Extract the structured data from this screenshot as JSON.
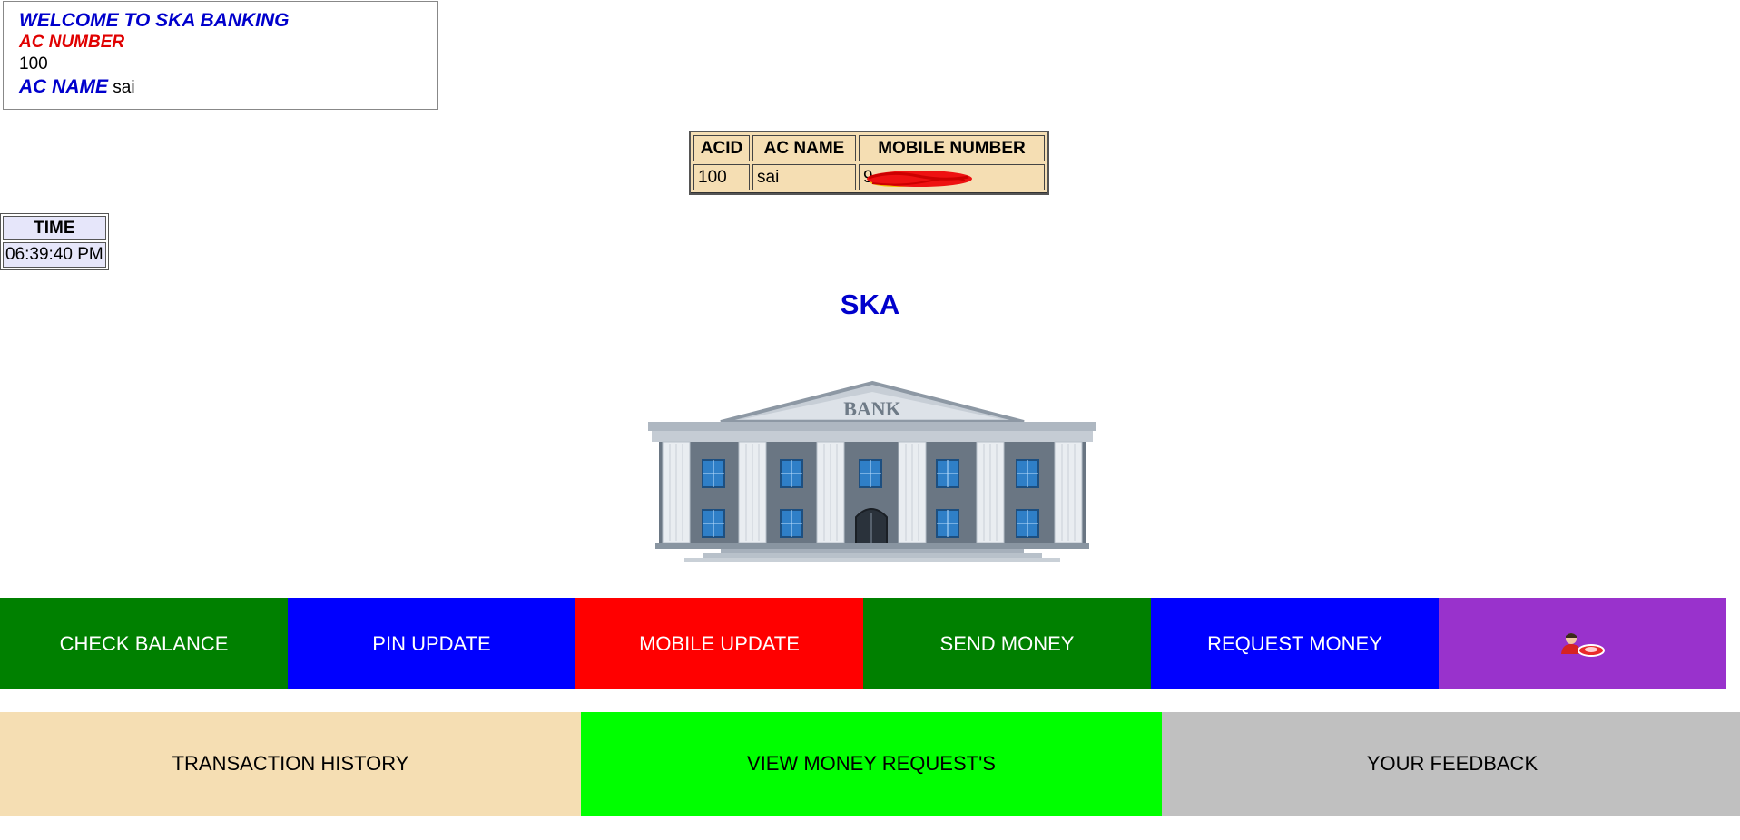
{
  "welcome": {
    "title": "WELCOME TO SKA BANKING",
    "ac_number_label": "AC NUMBER",
    "ac_number_value": "100",
    "ac_name_label": "AC NAME",
    "ac_name_value": "sai"
  },
  "account_table": {
    "headers": [
      "ACID",
      "AC NAME",
      "MOBILE NUMBER"
    ],
    "row": {
      "acid": "100",
      "ac_name": "sai",
      "mobile": "9"
    }
  },
  "time_table": {
    "header": "TIME",
    "value": "06:39:40 PM"
  },
  "heading": "SKA",
  "bank_image": {
    "sign_text": "BANK"
  },
  "actions_row1": [
    {
      "label": "CHECK BALANCE",
      "color": "#008000"
    },
    {
      "label": "PIN UPDATE",
      "color": "#0000ff"
    },
    {
      "label": "MOBILE UPDATE",
      "color": "#ff0000"
    },
    {
      "label": "SEND MONEY",
      "color": "#008000"
    },
    {
      "label": "REQUEST MONEY",
      "color": "#0000ff"
    },
    {
      "label": "",
      "icon": "logout-user-icon",
      "color": "#9932cc"
    }
  ],
  "actions_row2": [
    {
      "label": "TRANSACTION HISTORY",
      "color": "#f5deb3"
    },
    {
      "label": "VIEW MONEY REQUEST'S",
      "color": "#00ff00"
    },
    {
      "label": "YOUR FEEDBACK",
      "color": "#c0c0c0"
    }
  ]
}
